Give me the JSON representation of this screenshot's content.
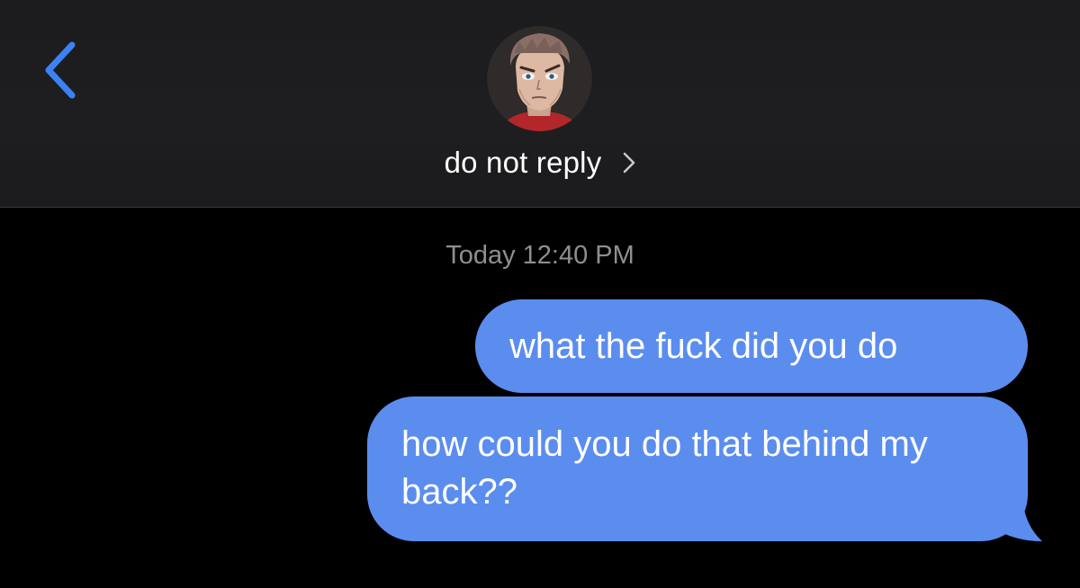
{
  "header": {
    "back_icon": "chevron-left-icon",
    "avatar_icon": "contact-avatar",
    "contact_name": "do not reply",
    "contact_chevron_icon": "chevron-right-icon"
  },
  "conversation": {
    "timestamp": "Today 12:40 PM",
    "messages": [
      {
        "sender": "me",
        "text": "what the fuck did you do"
      },
      {
        "sender": "me",
        "text": "how could you do that behind my back??"
      }
    ]
  },
  "colors": {
    "outgoing_bubble": "#5b8def",
    "accent": "#3b82f6",
    "header_bg": "#1c1c1e",
    "background": "#000000",
    "timestamp_text": "#8e8e93"
  }
}
